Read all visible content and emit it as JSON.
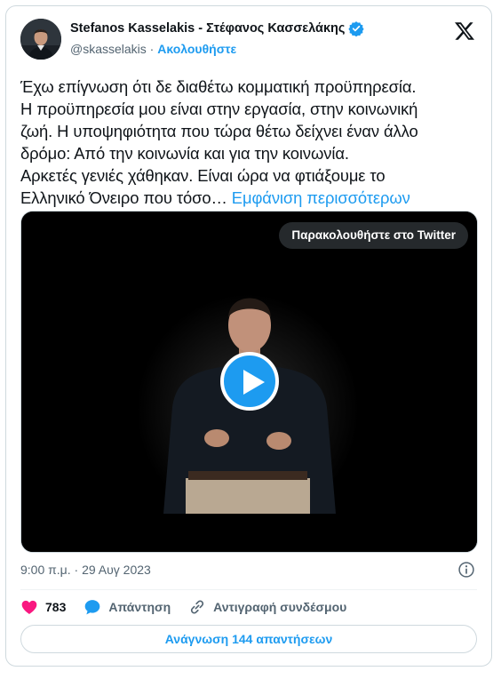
{
  "author": {
    "display_name": "Stefanos Kasselakis - Στέφανος Κασσελάκης",
    "handle": "@skasselakis",
    "separator": " · ",
    "follow_label": "Ακολουθήστε"
  },
  "tweet": {
    "lines": [
      "Έχω επίγνωση ότι δε διαθέτω κομματική προϋπηρεσία.",
      "Η προϋπηρεσία μου είναι στην εργασία, στην κοινωνική",
      "ζωή. Η υποψηφιότητα που τώρα θέτω δείχνει έναν άλλο",
      "δρόμο: Από την κοινωνία και για την κοινωνία.",
      "Αρκετές γενιές χάθηκαν. Είναι ώρα να φτιάξουμε το",
      "Ελληνικό Όνειρο που τόσο…"
    ],
    "show_more": "Εμφάνιση περισσότερων",
    "timestamp": "9:00 π.μ. · 29 Αυγ 2023"
  },
  "media": {
    "watch_label": "Παρακολουθήστε στο Twitter"
  },
  "actions": {
    "like_count": "783",
    "reply_label": "Απάντηση",
    "copy_link_label": "Αντιγραφή συνδέσμου"
  },
  "read_replies_label": "Ανάγνωση 144 απαντήσεων",
  "colors": {
    "accent": "#1d9bf0",
    "like": "#f91880",
    "muted": "#536471",
    "text": "#0f1419",
    "border": "#cfd9de"
  },
  "icons": {
    "verified": "verified-badge-icon",
    "x_logo": "x-logo-icon",
    "play": "play-icon",
    "info": "info-icon",
    "like": "heart-icon",
    "reply": "speech-bubble-icon",
    "copy_link": "link-icon"
  }
}
